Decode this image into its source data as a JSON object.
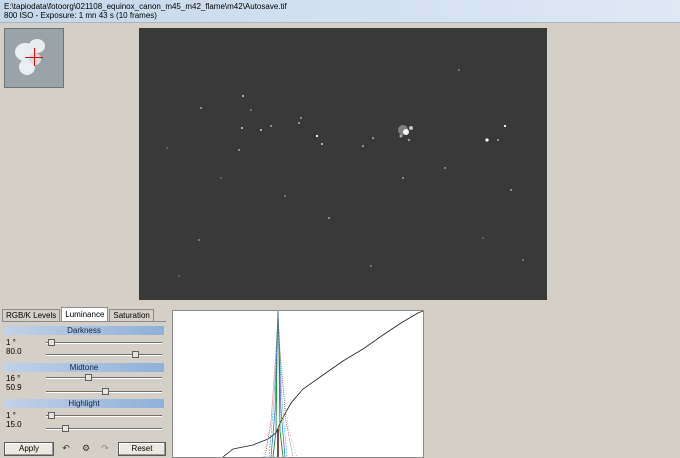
{
  "window": {
    "path": "E:\\tapiodata\\fotoorg\\021108_equinox_canon_m45_m42_flame\\m42\\Autosave.tif",
    "info": "800 ISO - Exposure: 1 mn 43 s (10 frames)"
  },
  "tabs": [
    "RGB/K Levels",
    "Luminance",
    "Saturation"
  ],
  "active_tab": "Luminance",
  "sections": {
    "darkness": {
      "title": "Darkness",
      "value1": "1 °",
      "value2": "80.0",
      "slider1": 0.02,
      "slider2": 0.79
    },
    "midtone": {
      "title": "Midtone",
      "value1": "16 °",
      "value2": "50.9",
      "slider1": 0.36,
      "slider2": 0.51
    },
    "highlight": {
      "title": "Highlight",
      "value1": "1 °",
      "value2": "15.0",
      "slider1": 0.02,
      "slider2": 0.15
    }
  },
  "buttons": {
    "apply": "Apply",
    "reset": "Reset"
  },
  "icons": {
    "undo": "undo-icon",
    "settings": "settings-icon",
    "redo": "redo-icon"
  },
  "colors": {
    "titlebar": "#c6d7ea",
    "section_header": "#8fb0d8",
    "image_bg": "#393939"
  }
}
